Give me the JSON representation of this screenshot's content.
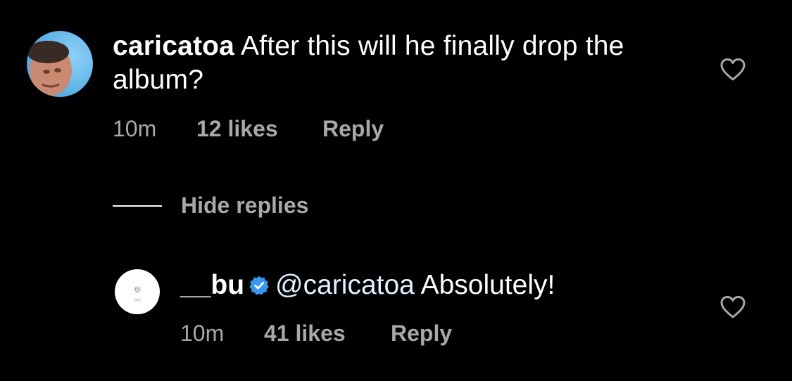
{
  "comment": {
    "username": "caricatoa",
    "text": "After this will he finally drop the album?",
    "time": "10m",
    "likes": "12 likes",
    "reply_label": "Reply"
  },
  "hide_replies_label": "Hide replies",
  "reply": {
    "username": "__bu",
    "verified": true,
    "mention": "@caricatoa",
    "text": "Absolutely!",
    "time": "10m",
    "likes": "41 likes",
    "reply_label": "Reply"
  },
  "icons": {
    "like": "heart-outline-icon",
    "verified": "verified-badge-icon"
  },
  "colors": {
    "background": "#000000",
    "text": "#ffffff",
    "meta": "#a8a8a8",
    "verified": "#3897f0"
  }
}
